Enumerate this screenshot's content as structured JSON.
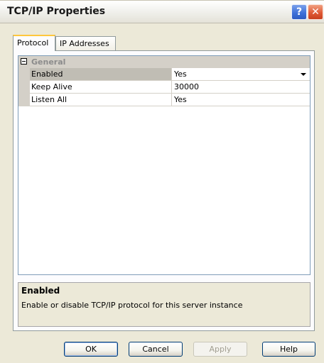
{
  "window": {
    "title": "TCP/IP Properties",
    "help_glyph": "?",
    "close_glyph": "✕"
  },
  "tabs": [
    {
      "label": "Protocol",
      "active": true
    },
    {
      "label": "IP Addresses",
      "active": false
    }
  ],
  "property_grid": {
    "category": "General",
    "properties": [
      {
        "name": "Enabled",
        "value": "Yes",
        "selected": true,
        "has_dropdown": true
      },
      {
        "name": "Keep Alive",
        "value": "30000",
        "selected": false,
        "has_dropdown": false
      },
      {
        "name": "Listen All",
        "value": "Yes",
        "selected": false,
        "has_dropdown": false
      }
    ]
  },
  "description": {
    "title": "Enabled",
    "text": "Enable or disable TCP/IP protocol for this server instance"
  },
  "buttons": {
    "ok": "OK",
    "cancel": "Cancel",
    "apply": "Apply",
    "help": "Help"
  },
  "colors": {
    "dialog_bg": "#ece9d8",
    "selected_row": "#c0bdb4",
    "category_row": "#d4d0c8",
    "active_tab_highlight": "#ffc73c",
    "close_button": "#e05a36",
    "help_button": "#3c6fd8"
  }
}
